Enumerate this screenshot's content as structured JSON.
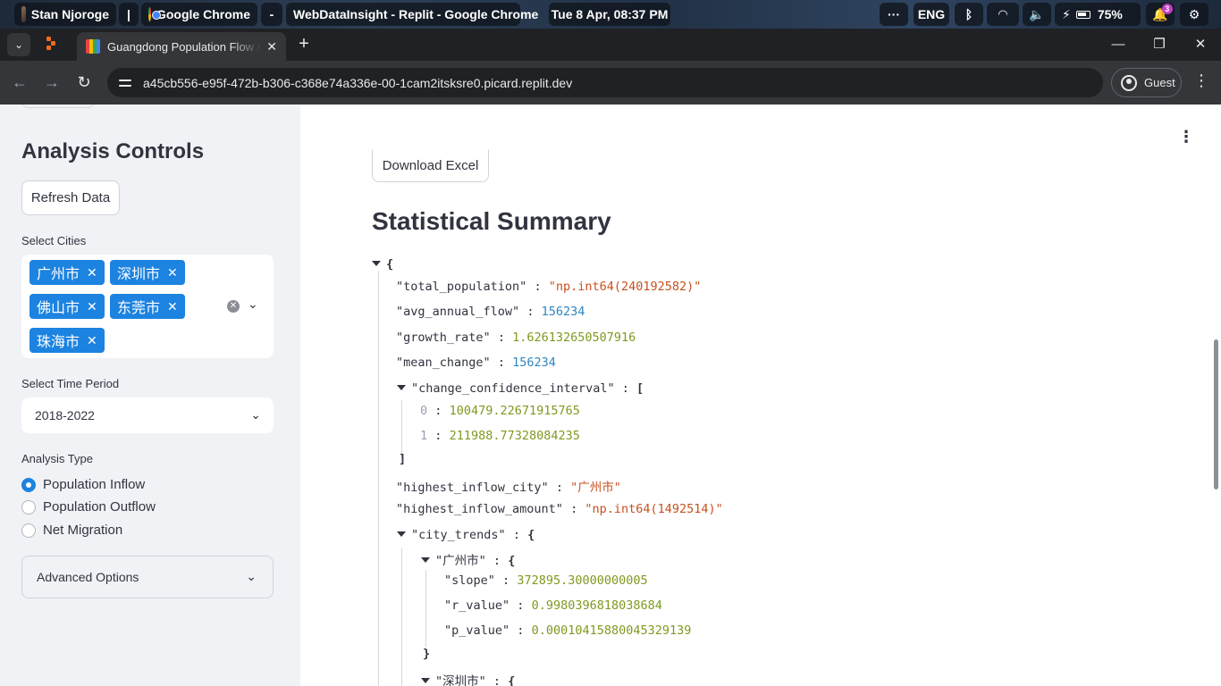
{
  "os_bar": {
    "user": "Stan Njoroge",
    "separator": "|",
    "app": "Google Chrome",
    "dash": "-",
    "window_title": "WebDataInsight - Replit - Google Chrome",
    "datetime": "Tue 8 Apr, 08:37 PM",
    "overflow": "···",
    "language": "ENG",
    "battery": "75%",
    "notifications_count": "3"
  },
  "browser": {
    "tab_title": "Guangdong Population Flow An",
    "tab_close": "✕",
    "new_tab": "+",
    "url": "a45cb556-e95f-472b-b306-c368e74a336e-00-1cam2itsksre0.picard.replit.dev",
    "profile_label": "Guest",
    "minimize": "—",
    "restore": "❐",
    "close": "✕"
  },
  "sidebar": {
    "heading": "Analysis Controls",
    "refresh_label": "Refresh Data",
    "cities_label": "Select Cities",
    "selected_cities": [
      "广州市",
      "深圳市",
      "佛山市",
      "东莞市",
      "珠海市"
    ],
    "chip_remove": "✕",
    "time_label": "Select Time Period",
    "time_value": "2018-2022",
    "analysis_label": "Analysis Type",
    "analysis_options": [
      "Population Inflow",
      "Population Outflow",
      "Net Migration"
    ],
    "analysis_selected": "Population Inflow",
    "advanced_label": "Advanced Options"
  },
  "main": {
    "download_label": "Download Excel",
    "summary_title": "Statistical Summary",
    "json": {
      "open_brace": "{",
      "total_population_key": "\"total_population\"",
      "total_population_val": "\"np.int64(240192582)\"",
      "avg_annual_flow_key": "\"avg_annual_flow\"",
      "avg_annual_flow_val": "156234",
      "growth_rate_key": "\"growth_rate\"",
      "growth_rate_val": "1.626132650507916",
      "mean_change_key": "\"mean_change\"",
      "mean_change_val": "156234",
      "ci_key": "\"change_confidence_interval\"",
      "ci_open": "[",
      "ci_0_idx": "0",
      "ci_0_val": "100479.22671915765",
      "ci_1_idx": "1",
      "ci_1_val": "211988.77328084235",
      "ci_close": "]",
      "hic_key": "\"highest_inflow_city\"",
      "hic_val": "\"广州市\"",
      "hia_key": "\"highest_inflow_amount\"",
      "hia_val": "\"np.int64(1492514)\"",
      "ct_key": "\"city_trends\"",
      "ct_open": "{",
      "gz_key": "\"广州市\"",
      "gz_open": "{",
      "slope_key": "\"slope\"",
      "slope_val": "372895.30000000005",
      "r_key": "\"r_value\"",
      "r_val": "0.9980396818038684",
      "p_key": "\"p_value\"",
      "p_val": "0.00010415880045329139",
      "gz_close": "}",
      "sz_key": "\"深圳市\"",
      "sz_open": "{",
      "colon": ":"
    }
  }
}
